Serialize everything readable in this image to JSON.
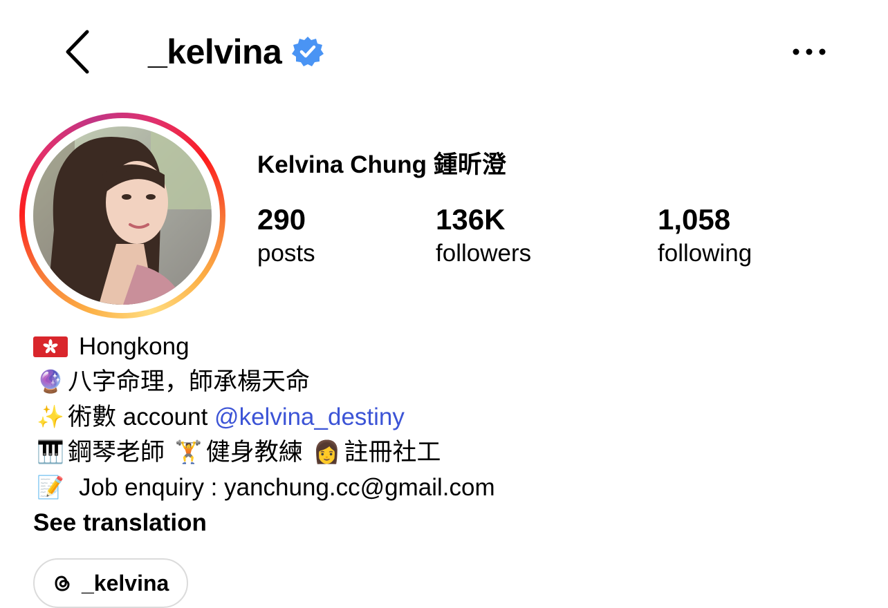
{
  "header": {
    "username": "_kelvina",
    "verified": true,
    "accent_color": "#4a94f4"
  },
  "profile": {
    "display_name": "Kelvina Chung 鍾昕澄",
    "stats": {
      "posts_value": "290",
      "posts_label": "posts",
      "followers_value": "136K",
      "followers_label": "followers",
      "following_value": "1,058",
      "following_label": "following"
    }
  },
  "bio": {
    "location_icon": "hong-kong-flag-icon",
    "location": "Hongkong",
    "line2_icon": "🔮",
    "line2_text": "八字命理，師承楊天命",
    "line3_icon": "✨",
    "line3_text": "術數 account ",
    "line3_mention": "@kelvina_destiny",
    "line4_icon1": "🎹",
    "line4_text1": "鋼琴老師 ",
    "line4_icon2": "🏋",
    "line4_text2": "健身教練 ",
    "line4_icon3": "👩",
    "line4_text3": "註冊社工",
    "line5_icon": "📝",
    "line5_text": "Job enquiry : yanchung.cc@gmail.com",
    "see_translation": "See translation",
    "mention_color": "#3c54d6"
  },
  "threads": {
    "icon": "threads-icon",
    "label": "_kelvina"
  }
}
